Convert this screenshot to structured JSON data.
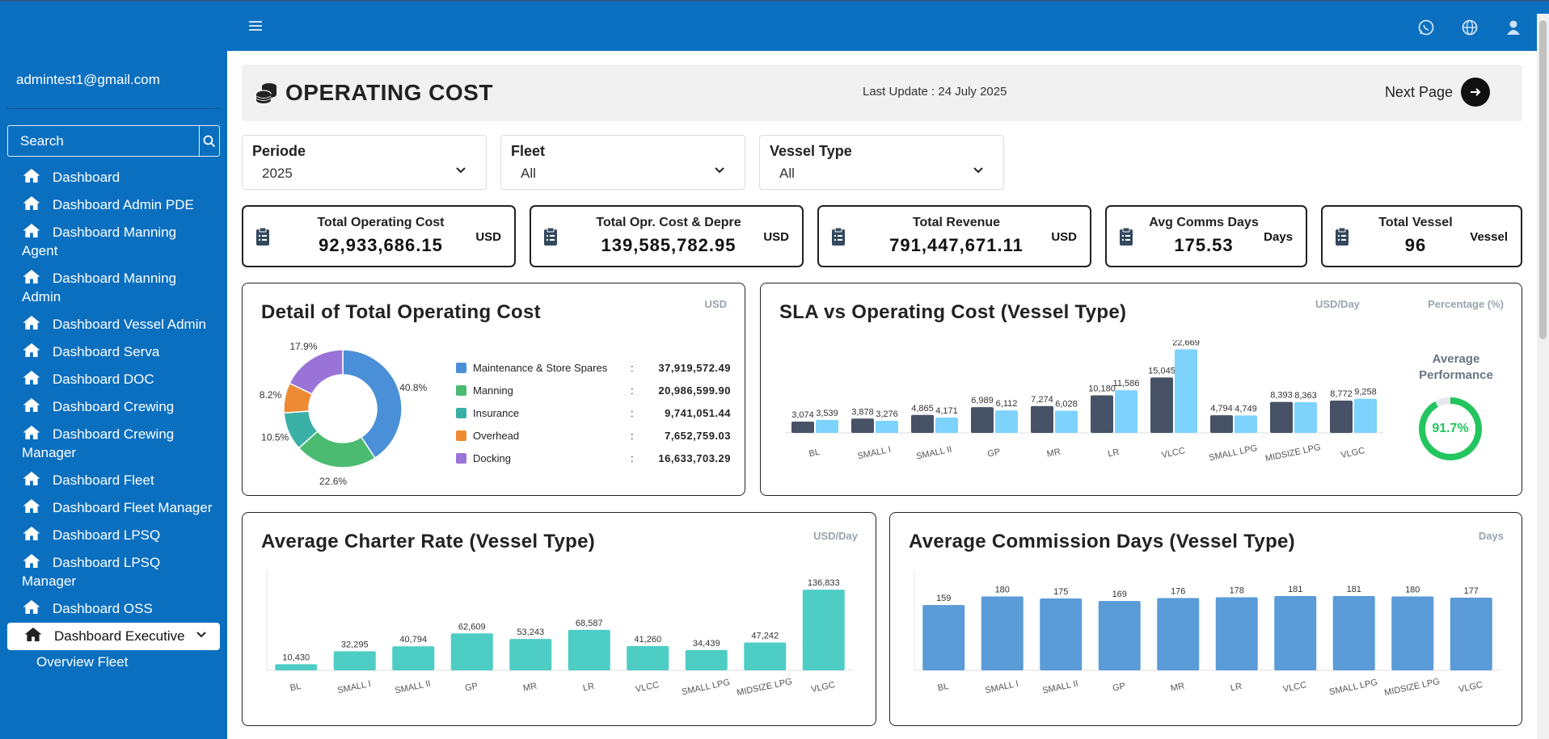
{
  "user": {
    "email": "admintest1@gmail.com"
  },
  "search": {
    "placeholder": "Search"
  },
  "sidebar": {
    "items": [
      {
        "label": "Dashboard"
      },
      {
        "label": "Dashboard Admin PDE"
      },
      {
        "label": "Dashboard Manning Agent"
      },
      {
        "label": "Dashboard Manning Admin"
      },
      {
        "label": "Dashboard Vessel Admin"
      },
      {
        "label": "Dashboard Serva"
      },
      {
        "label": "Dashboard DOC"
      },
      {
        "label": "Dashboard Crewing"
      },
      {
        "label": "Dashboard Crewing Manager"
      },
      {
        "label": "Dashboard Fleet"
      },
      {
        "label": "Dashboard Fleet Manager"
      },
      {
        "label": "Dashboard LPSQ"
      },
      {
        "label": "Dashboard LPSQ Manager"
      },
      {
        "label": "Dashboard OSS"
      }
    ],
    "active": {
      "label": "Dashboard Executive"
    },
    "subitem": {
      "label": "Overview Fleet"
    }
  },
  "header": {
    "title": "OPERATING COST",
    "last_update": "Last Update : 24 July 2025",
    "next_page": "Next Page"
  },
  "filters": {
    "periode": {
      "label": "Periode",
      "value": "2025"
    },
    "fleet": {
      "label": "Fleet",
      "value": "All"
    },
    "vessel_type": {
      "label": "Vessel Type",
      "value": "All"
    }
  },
  "kpis": {
    "total_operating_cost": {
      "label": "Total Operating Cost",
      "value": "92,933,686.15",
      "unit": "USD"
    },
    "total_opr_cost_depre": {
      "label": "Total Opr. Cost & Depre",
      "value": "139,585,782.95",
      "unit": "USD"
    },
    "total_revenue": {
      "label": "Total Revenue",
      "value": "791,447,671.11",
      "unit": "USD"
    },
    "avg_comms_days": {
      "label": "Avg Comms Days",
      "value": "175.53",
      "unit": "Days"
    },
    "total_vessel": {
      "label": "Total Vessel",
      "value": "96",
      "unit": "Vessel"
    }
  },
  "cards": {
    "detail": {
      "title": "Detail of Total Operating Cost",
      "unit": "USD"
    },
    "sla": {
      "title": "SLA vs Operating Cost (Vessel Type)",
      "unit1": "USD/Day",
      "unit2": "Percentage (%)",
      "perf_label": "Average Performance",
      "perf_value": "91.7%"
    },
    "charter": {
      "title": "Average Charter Rate (Vessel Type)",
      "unit": "USD/Day"
    },
    "commission": {
      "title": "Average Commission Days (Vessel Type)",
      "unit": "Days"
    }
  },
  "chart_data": [
    {
      "type": "pie",
      "name": "detail_total_operating_cost",
      "labels": [
        "Maintenance & Store Spares",
        "Manning",
        "Insurance",
        "Overhead",
        "Docking"
      ],
      "values": [
        37919572.49,
        20986599.9,
        9741051.44,
        7652759.03,
        16633703.29
      ],
      "value_labels": [
        "37,919,572.49",
        "20,986,599.90",
        "9,741,051.44",
        "7,652,759.03",
        "16,633,703.29"
      ],
      "percent_labels": [
        "40.8%",
        "22.6%",
        "10.5%",
        "8.2%",
        "17.9%"
      ],
      "colors": [
        "#4a90d9",
        "#4cbb72",
        "#3ab0a6",
        "#ee8a34",
        "#9a73d8"
      ]
    },
    {
      "type": "bar",
      "name": "sla_vs_operating_cost",
      "categories": [
        "BL",
        "SMALL I",
        "SMALL II",
        "GP",
        "MR",
        "LR",
        "VLCC",
        "SMALL LPG",
        "MIDSIZE LPG",
        "VLGC"
      ],
      "series": [
        {
          "values": [
            3074,
            3878,
            4865,
            6989,
            7274,
            10180,
            15045,
            4794,
            8393,
            8772
          ],
          "labels": [
            "3,074",
            "3,878",
            "4,865",
            "6,989",
            "7,274",
            "10,180",
            "15,045",
            "4,794",
            "8,393",
            "8,772"
          ],
          "color": "#475266"
        },
        {
          "values": [
            3539,
            3276,
            4171,
            6112,
            6028,
            11586,
            22669,
            4749,
            8363,
            9258
          ],
          "labels": [
            "3,539",
            "3,276",
            "4,171",
            "6,112",
            "6,028",
            "11,586",
            "22,669",
            "4,749",
            "8,363",
            "9,258"
          ],
          "color": "#7dd3fc"
        }
      ],
      "ylim": [
        0,
        23000
      ]
    },
    {
      "type": "bar",
      "name": "average_charter_rate",
      "categories": [
        "BL",
        "SMALL I",
        "SMALL II",
        "GP",
        "MR",
        "LR",
        "VLCC",
        "SMALL LPG",
        "MIDSIZE LPG",
        "VLGC"
      ],
      "values": [
        10430,
        32295,
        40794,
        62609,
        53243,
        68587,
        41260,
        34439,
        47242,
        136833
      ],
      "labels": [
        "10,430",
        "32,295",
        "40,794",
        "62,609",
        "53,243",
        "68,587",
        "41,260",
        "34,439",
        "47,242",
        "136,833"
      ],
      "color": "#4ecdc4",
      "ylim": [
        0,
        137000
      ]
    },
    {
      "type": "bar",
      "name": "average_commission_days",
      "categories": [
        "BL",
        "SMALL I",
        "SMALL II",
        "GP",
        "MR",
        "LR",
        "VLCC",
        "SMALL LPG",
        "MIDSIZE LPG",
        "VLGC"
      ],
      "values": [
        159,
        180,
        175,
        169,
        176,
        178,
        181,
        181,
        180,
        177
      ],
      "labels": [
        "159",
        "180",
        "175",
        "169",
        "176",
        "178",
        "181",
        "181",
        "180",
        "177"
      ],
      "color": "#5a9bd8",
      "ylim": [
        0,
        181
      ]
    }
  ]
}
